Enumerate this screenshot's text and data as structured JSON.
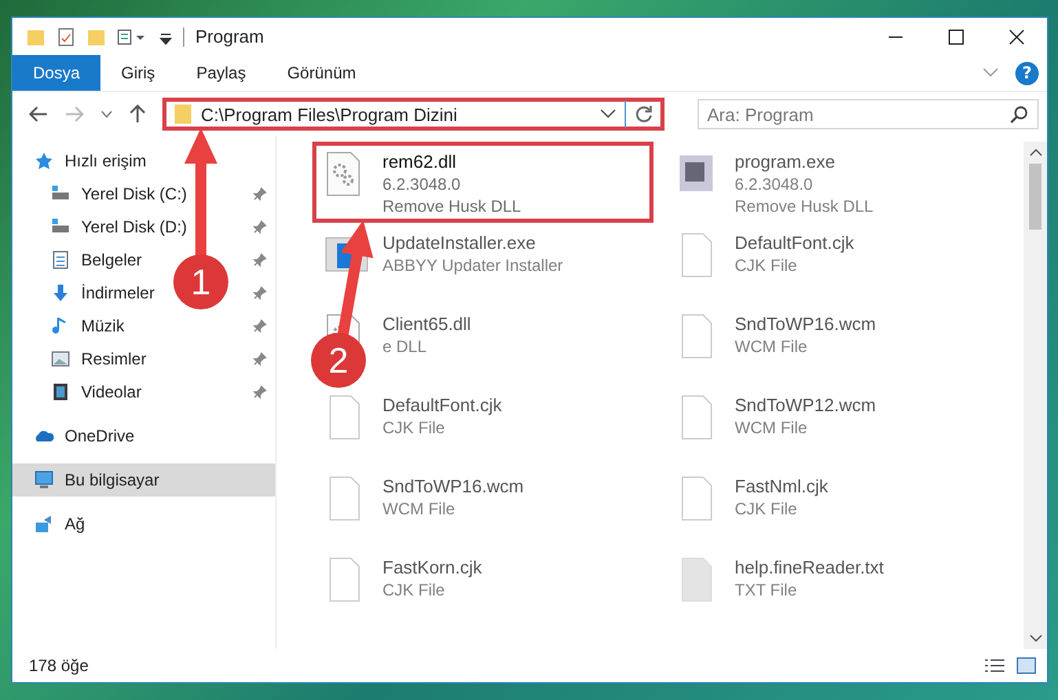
{
  "window": {
    "title": "Program"
  },
  "ribbon_tabs": [
    {
      "label": "Dosya",
      "selected": true
    },
    {
      "label": "Giriş",
      "selected": false
    },
    {
      "label": "Paylaş",
      "selected": false
    },
    {
      "label": "Görünüm",
      "selected": false
    }
  ],
  "help_button": {
    "label": "?"
  },
  "address": {
    "value": "C:\\Program Files\\Program Dizini",
    "highlighted": true
  },
  "search": {
    "placeholder": "Ara: Program"
  },
  "sidebar": {
    "items": [
      {
        "label": "Hızlı erişim",
        "kind": "star",
        "pinned": false,
        "selected": false,
        "children": [
          {
            "label": "Yerel Disk (C:)",
            "kind": "drive",
            "pinned": true,
            "selected": false
          },
          {
            "label": "Yerel Disk (D:)",
            "kind": "drive",
            "pinned": true,
            "selected": false
          },
          {
            "label": "Belgeler",
            "kind": "doc",
            "pinned": true,
            "selected": false
          },
          {
            "label": "İndirmeler",
            "kind": "download",
            "pinned": true,
            "selected": false
          },
          {
            "label": "Müzik",
            "kind": "music",
            "pinned": true,
            "selected": false
          },
          {
            "label": "Resimler",
            "kind": "picture",
            "pinned": true,
            "selected": false
          },
          {
            "label": "Videolar",
            "kind": "film",
            "pinned": true,
            "selected": false
          }
        ]
      },
      {
        "label": "OneDrive",
        "kind": "cloud",
        "pinned": false,
        "selected": false
      },
      {
        "label": "Bu bilgisayar",
        "kind": "pc",
        "pinned": false,
        "selected": true
      },
      {
        "label": "Ağ",
        "kind": "network",
        "pinned": false,
        "selected": false
      }
    ]
  },
  "files": [
    {
      "name": "rem62.dll",
      "lines": [
        "6.2.3048.0",
        "Remove Husk DLL"
      ],
      "kind": "gears",
      "highlighted": true
    },
    {
      "name": "program.exe",
      "lines": [
        "6.2.3048.0",
        "Remove Husk DLL"
      ],
      "kind": "app",
      "highlighted": false
    },
    {
      "name": "UpdateInstaller.exe",
      "lines": [
        "ABBYY Updater Installer"
      ],
      "kind": "window",
      "highlighted": false
    },
    {
      "name": "DefaultFont.cjk",
      "lines": [
        "CJK File"
      ],
      "kind": "page",
      "highlighted": false
    },
    {
      "name": "Client65.dll",
      "lines": [
        "e DLL"
      ],
      "kind": "gears",
      "highlighted": false
    },
    {
      "name": "SndToWP16.wcm",
      "lines": [
        "WCM File"
      ],
      "kind": "page",
      "highlighted": false
    },
    {
      "name": "DefaultFont.cjk",
      "lines": [
        "CJK File"
      ],
      "kind": "page",
      "highlighted": false
    },
    {
      "name": "SndToWP12.wcm",
      "lines": [
        "WCM File"
      ],
      "kind": "page",
      "highlighted": false
    },
    {
      "name": "SndToWP16.wcm",
      "lines": [
        "WCM File"
      ],
      "kind": "page",
      "highlighted": false
    },
    {
      "name": "FastNml.cjk",
      "lines": [
        "CJK File"
      ],
      "kind": "page",
      "highlighted": false
    },
    {
      "name": "FastKorn.cjk",
      "lines": [
        "CJK File"
      ],
      "kind": "page",
      "highlighted": false
    },
    {
      "name": "help.fineReader.txt",
      "lines": [
        "TXT File"
      ],
      "kind": "blank",
      "highlighted": false
    }
  ],
  "status_bar": {
    "count": "178 öğe"
  },
  "annotations": [
    {
      "number": "1"
    },
    {
      "number": "2"
    }
  ]
}
